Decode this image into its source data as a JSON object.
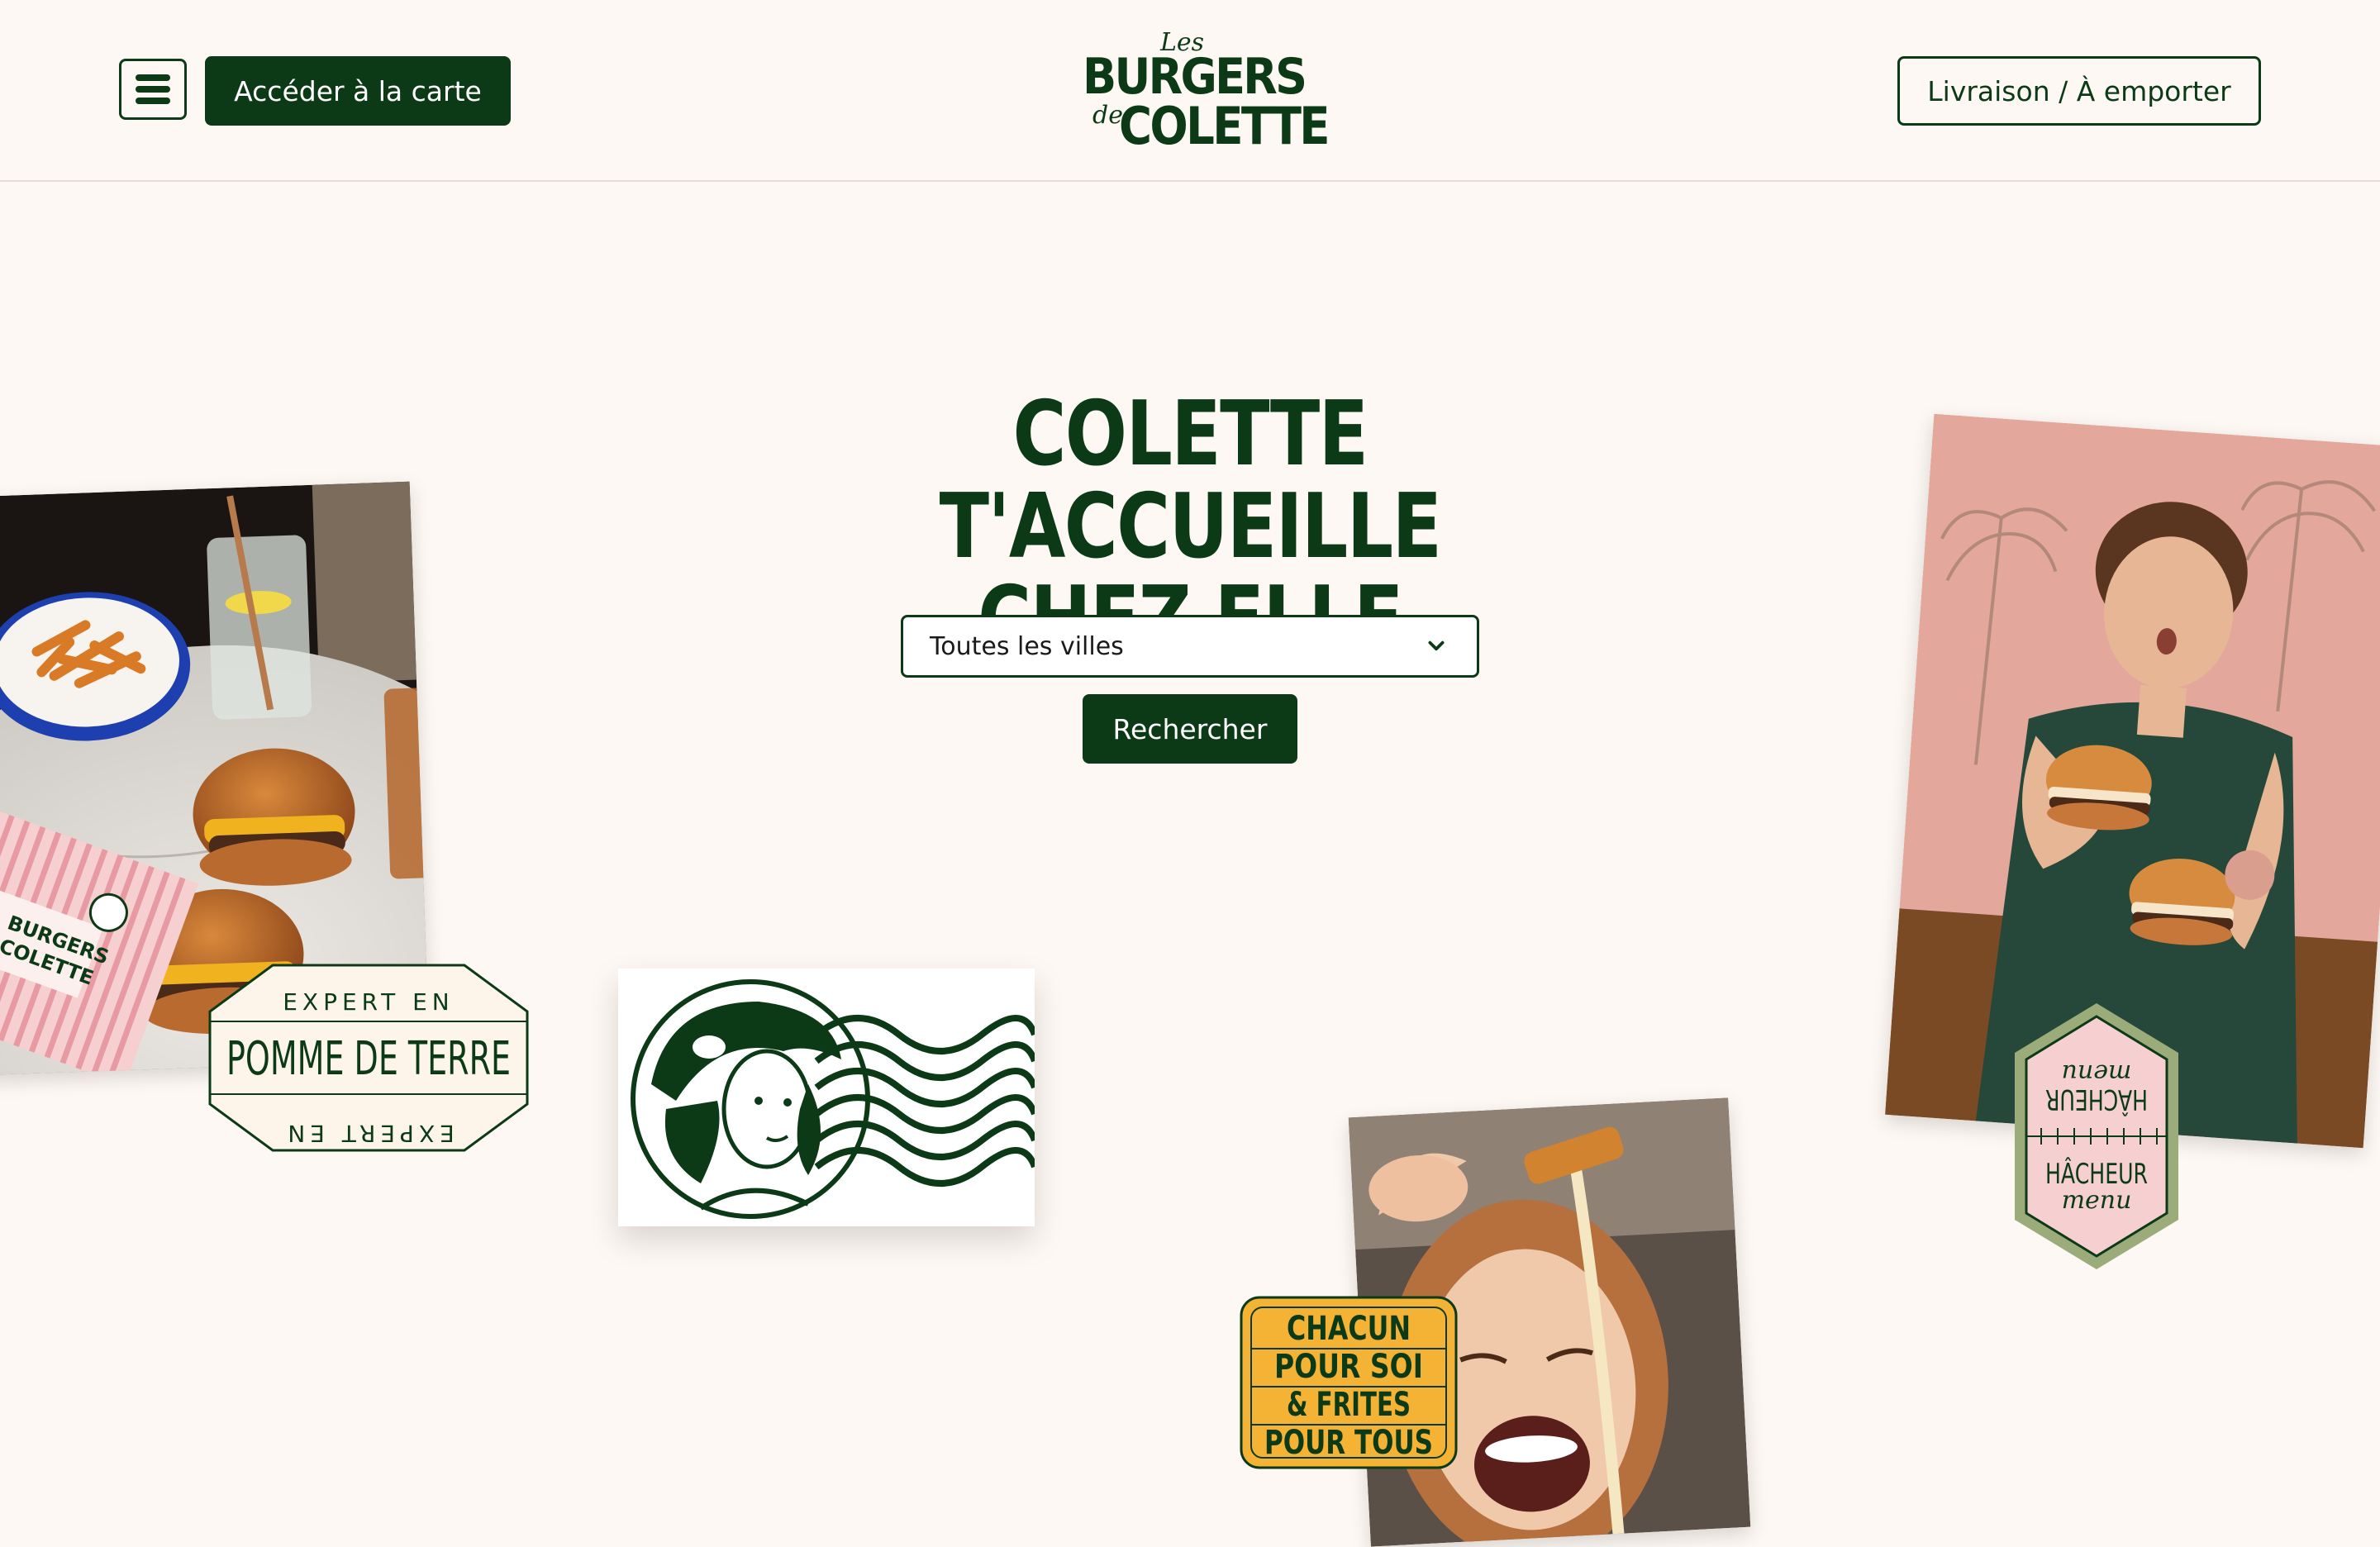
{
  "header": {
    "menu_icon": "hamburger-menu-icon",
    "carte_label": "Accéder à la carte",
    "delivery_label": "Livraison / À emporter",
    "logo": {
      "les": "Les",
      "burgers": "BURGERS",
      "de": "de",
      "colette": "COLETTE"
    }
  },
  "hero": {
    "title_line1": "COLETTE T'ACCUEILLE",
    "title_line2": "CHEZ ELLE",
    "city_select": {
      "selected": "Toutes les villes",
      "icon": "chevron-down-icon"
    },
    "search_label": "Rechercher"
  },
  "badges": {
    "potato": {
      "top": "EXPERT EN",
      "main": "POMME DE TERRE",
      "bottom": "EXPERT EN"
    },
    "hacheur": {
      "word": "HÂCHEUR",
      "sub": "menu"
    },
    "chacun": {
      "line1": "CHACUN",
      "line2": "POUR SOI",
      "line3": "& FRITES",
      "line4": "POUR TOUS"
    },
    "menu_card": {
      "burgers": "BURGERS",
      "colette": "COLETTE"
    }
  },
  "colors": {
    "brand_green": "#0c3a16",
    "background": "#fdf8f3",
    "badge_yellow": "#f5b335",
    "badge_pink": "#f6cfd0",
    "badge_olive": "#9cab7a"
  }
}
